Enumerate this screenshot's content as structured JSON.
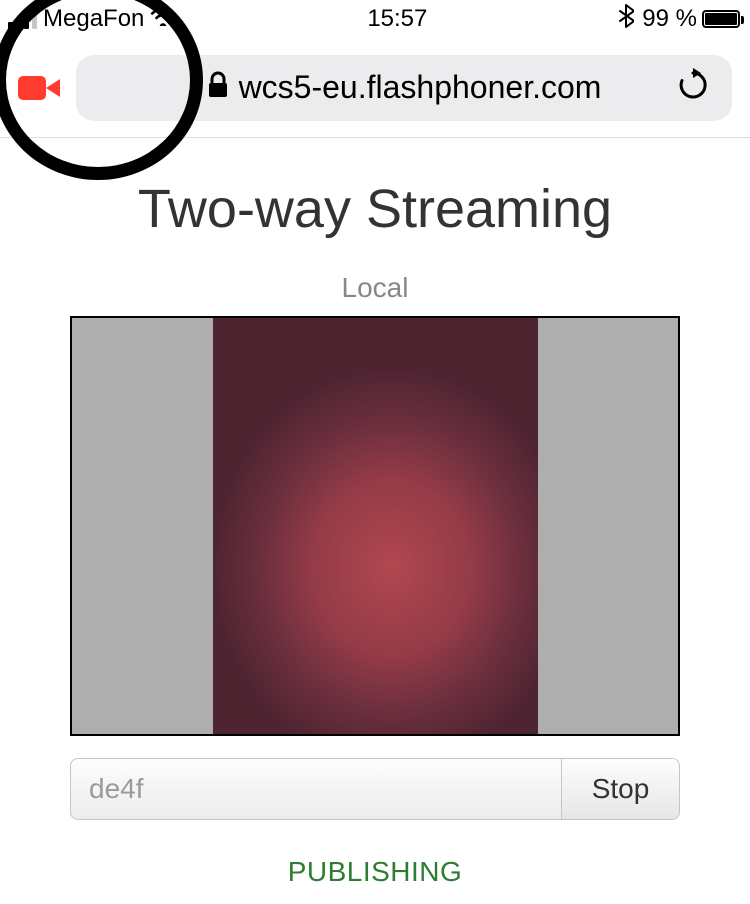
{
  "status_bar": {
    "carrier": "MegaFon",
    "time": "15:57",
    "battery_percent": "99 %"
  },
  "browser": {
    "domain": "wcs5-eu.flashphoner.com"
  },
  "page": {
    "title": "Two-way Streaming",
    "local_label": "Local",
    "stream_id": "de4f",
    "stop_label": "Stop",
    "status": "PUBLISHING"
  }
}
